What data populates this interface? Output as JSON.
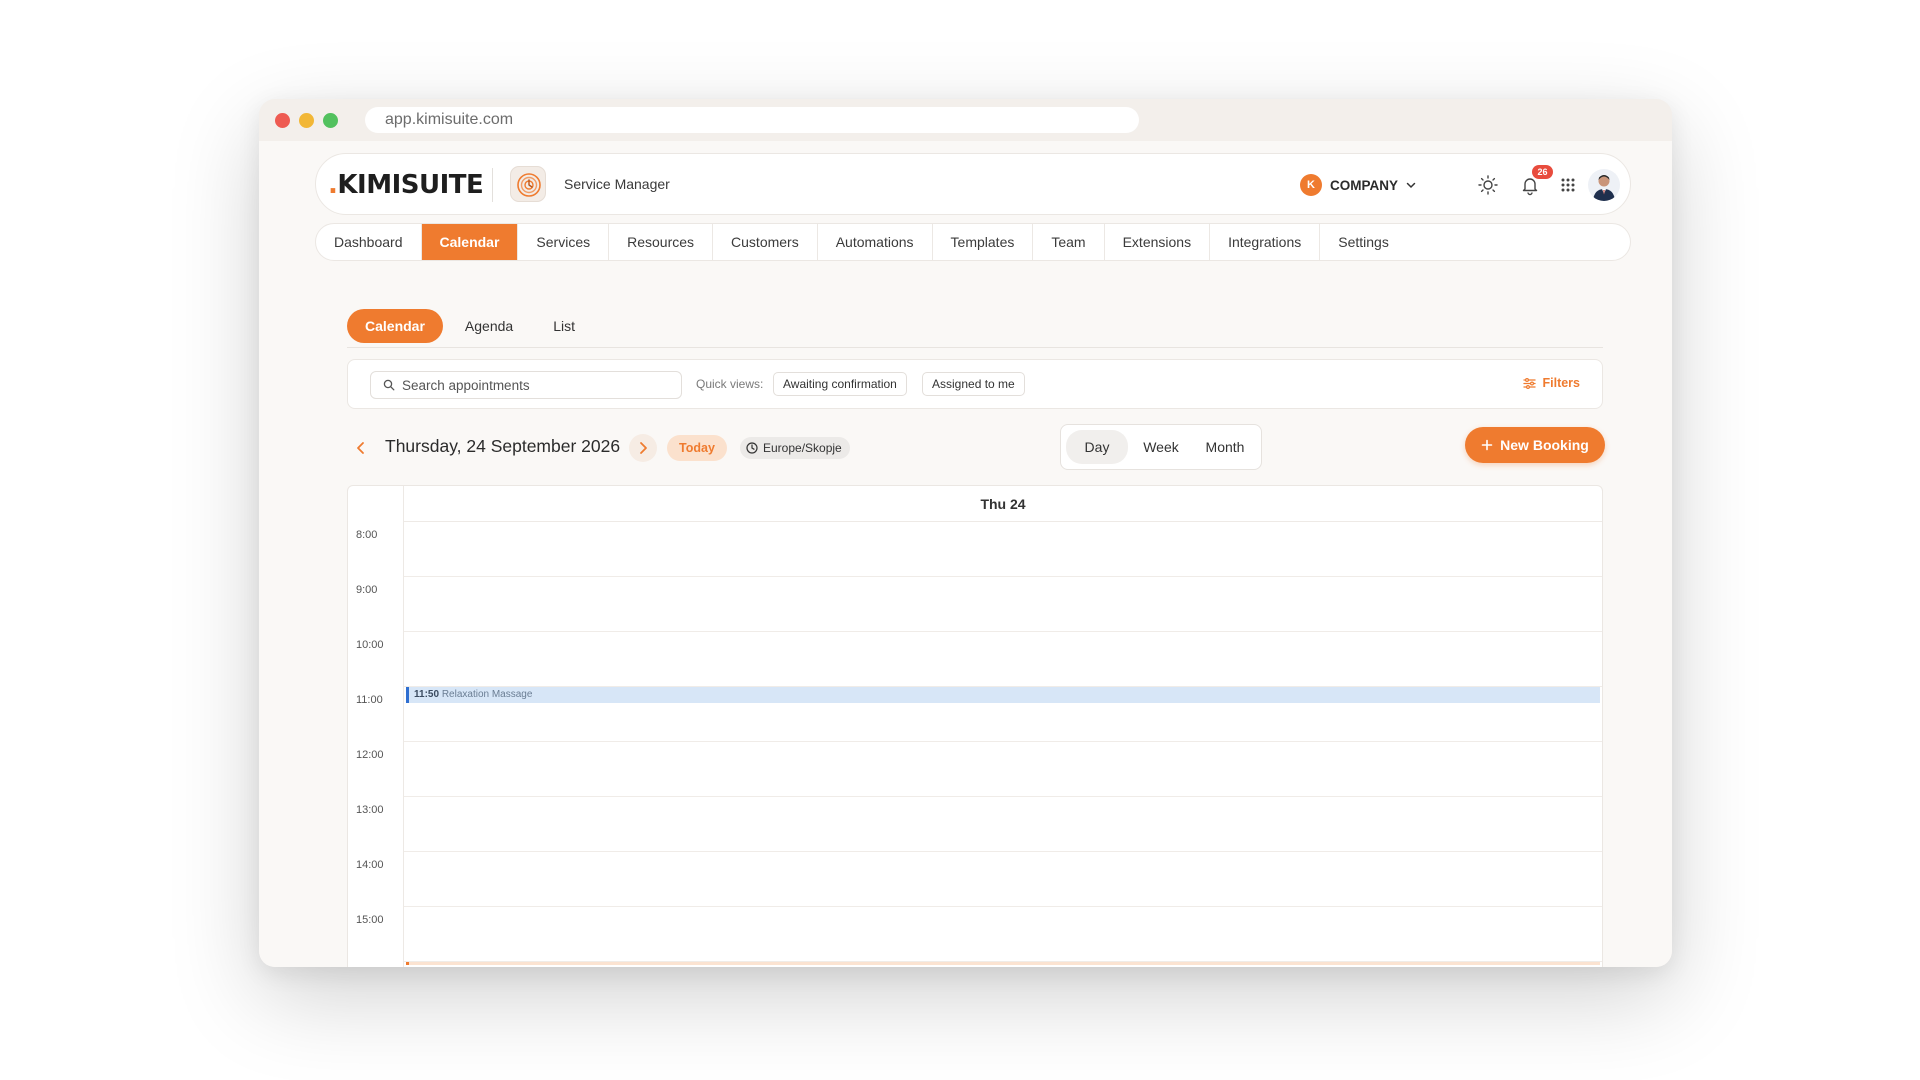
{
  "browser": {
    "url": "app.kimisuite.com"
  },
  "header": {
    "logo": "KIMISUITE",
    "logo_dot": ".",
    "app_name": "Service Manager",
    "company_initial": "K",
    "company": "COMPANY",
    "notifications": "26"
  },
  "nav": {
    "items": [
      {
        "label": "Dashboard"
      },
      {
        "label": "Calendar",
        "active": true
      },
      {
        "label": "Services"
      },
      {
        "label": "Resources"
      },
      {
        "label": "Customers"
      },
      {
        "label": "Automations"
      },
      {
        "label": "Templates"
      },
      {
        "label": "Team"
      },
      {
        "label": "Extensions"
      },
      {
        "label": "Integrations"
      },
      {
        "label": "Settings"
      }
    ]
  },
  "subtabs": {
    "items": [
      {
        "label": "Calendar",
        "active": true
      },
      {
        "label": "Agenda"
      },
      {
        "label": "List"
      }
    ]
  },
  "toolbar": {
    "search_placeholder": "Search appointments",
    "quick_views_label": "Quick views:",
    "quick_views": [
      "Awaiting confirmation",
      "Assigned to me"
    ],
    "filters": "Filters"
  },
  "datebar": {
    "date": "Thursday, 24 September 2026",
    "today": "Today",
    "timezone": "Europe/Skopje",
    "views": [
      "Day",
      "Week",
      "Month"
    ],
    "new_booking": "New Booking"
  },
  "calendar": {
    "day_header": "Thu 24",
    "hours": [
      "8:00",
      "9:00",
      "10:00",
      "11:00",
      "12:00",
      "13:00",
      "14:00",
      "15:00"
    ],
    "event": {
      "time": "11:50",
      "title": "Relaxation Massage"
    }
  },
  "colors": {
    "accent": "#ef7b2f",
    "event": "#d7e6f7",
    "event_border": "#2f6fd1",
    "badge": "#e84c3d"
  }
}
